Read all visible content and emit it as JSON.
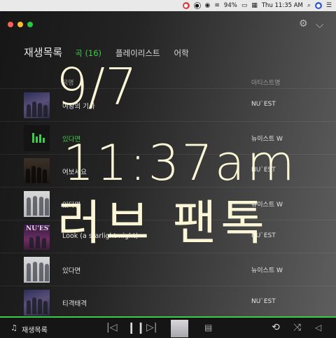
{
  "menubar": {
    "battery": "94%",
    "clock": "Thu 11:35 AM"
  },
  "window": {
    "header": {
      "title": "재생목록",
      "tabs": [
        {
          "label": "곡 (16)",
          "active": true
        },
        {
          "label": "플레이리스트",
          "active": false
        },
        {
          "label": "어학",
          "active": false
        }
      ]
    },
    "columns": {
      "title": "곡명",
      "artist": "아티스트명"
    },
    "songs": [
      {
        "title": "여왕의 기사",
        "artist": "NU`EST",
        "playing": false
      },
      {
        "title": "있다면",
        "artist": "뉴이스트 W",
        "playing": true
      },
      {
        "title": "여보세요",
        "artist": "NU`EST",
        "playing": false
      },
      {
        "title": "있다면",
        "artist": "뉴이스트 W",
        "playing": false
      },
      {
        "title": "Look (a starlight night)",
        "artist": "NU`EST",
        "playing": false
      },
      {
        "title": "있다면",
        "artist": "뉴이스트 W",
        "playing": false
      },
      {
        "title": "티격태격",
        "artist": "NU`EST",
        "playing": false
      }
    ],
    "album_art_text": "NU'EST"
  },
  "player": {
    "label": "재생목록"
  },
  "overlay": {
    "date": "9/7",
    "time": "11:37am",
    "caption": "러브 팬톡"
  },
  "colors": {
    "accent": "#3ecb4a",
    "overlay_text": "#fbf6d6"
  }
}
